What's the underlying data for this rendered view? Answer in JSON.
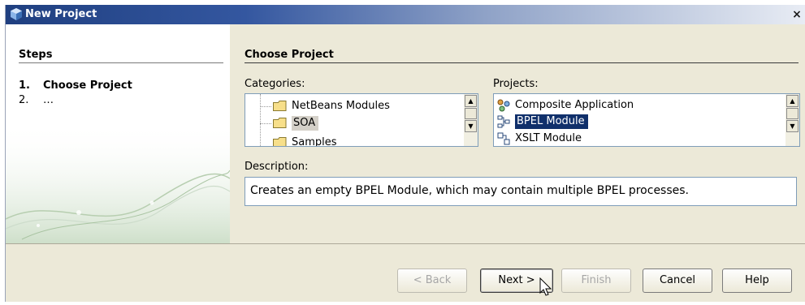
{
  "window": {
    "title": "New Project",
    "close_label": "×"
  },
  "steps": {
    "heading": "Steps",
    "items": [
      {
        "num": "1.",
        "label": "Choose Project"
      },
      {
        "num": "2.",
        "label": "…"
      }
    ]
  },
  "main": {
    "title": "Choose Project",
    "categories_label": "Categories:",
    "projects_label": "Projects:",
    "categories": [
      {
        "label": "NetBeans Modules"
      },
      {
        "label": "SOA"
      },
      {
        "label": "Samples"
      }
    ],
    "selected_category": "SOA",
    "projects": [
      {
        "label": "Composite Application"
      },
      {
        "label": "BPEL Module"
      },
      {
        "label": "XSLT Module"
      }
    ],
    "selected_project": "BPEL Module",
    "description_label": "Description:",
    "description": "Creates an empty BPEL Module, which may contain multiple BPEL processes."
  },
  "buttons": {
    "back": "< Back",
    "next": "Next >",
    "finish": "Finish",
    "cancel": "Cancel",
    "help": "Help"
  },
  "colors": {
    "title_bar": "#1f3f80",
    "selection": "#10306b",
    "dialog_bg": "#ece9d8"
  }
}
